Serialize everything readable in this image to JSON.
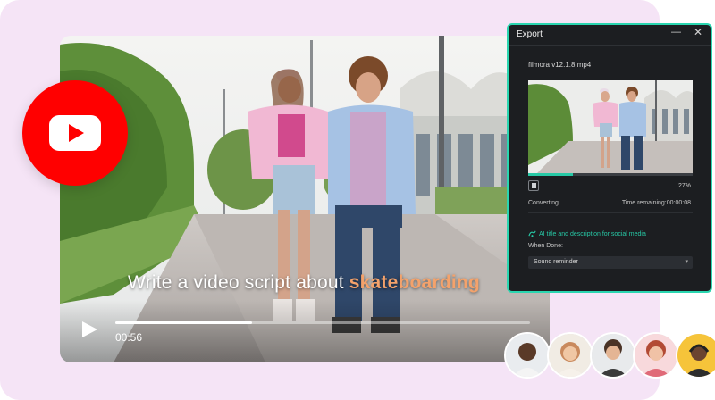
{
  "player": {
    "caption_prefix": "Write a video script about ",
    "caption_highlight": "skateboarding",
    "current_time": "00:56",
    "progress": 0.33
  },
  "youtube_logo": {
    "icon": "youtube-play-icon",
    "color": "#ff0000"
  },
  "export_panel": {
    "title": "Export",
    "minimize_icon": "minimize-icon",
    "close_icon": "close-icon",
    "filename": "filmora v12.1.8.mp4",
    "progress_percent": "27%",
    "progress": 0.27,
    "status": "Converting...",
    "time_remaining": "Time remaining:00:00:08",
    "ai_option": "AI title and description for social media",
    "when_done_label": "When Done:",
    "when_done_value": "Sound reminder",
    "accent_color": "#27c9a6"
  },
  "avatars": [
    {
      "name": "avatar-1",
      "icon": "person-avatar"
    },
    {
      "name": "avatar-2",
      "icon": "person-avatar"
    },
    {
      "name": "avatar-3",
      "icon": "person-avatar"
    },
    {
      "name": "avatar-4",
      "icon": "person-avatar"
    },
    {
      "name": "avatar-5",
      "icon": "person-avatar"
    }
  ]
}
